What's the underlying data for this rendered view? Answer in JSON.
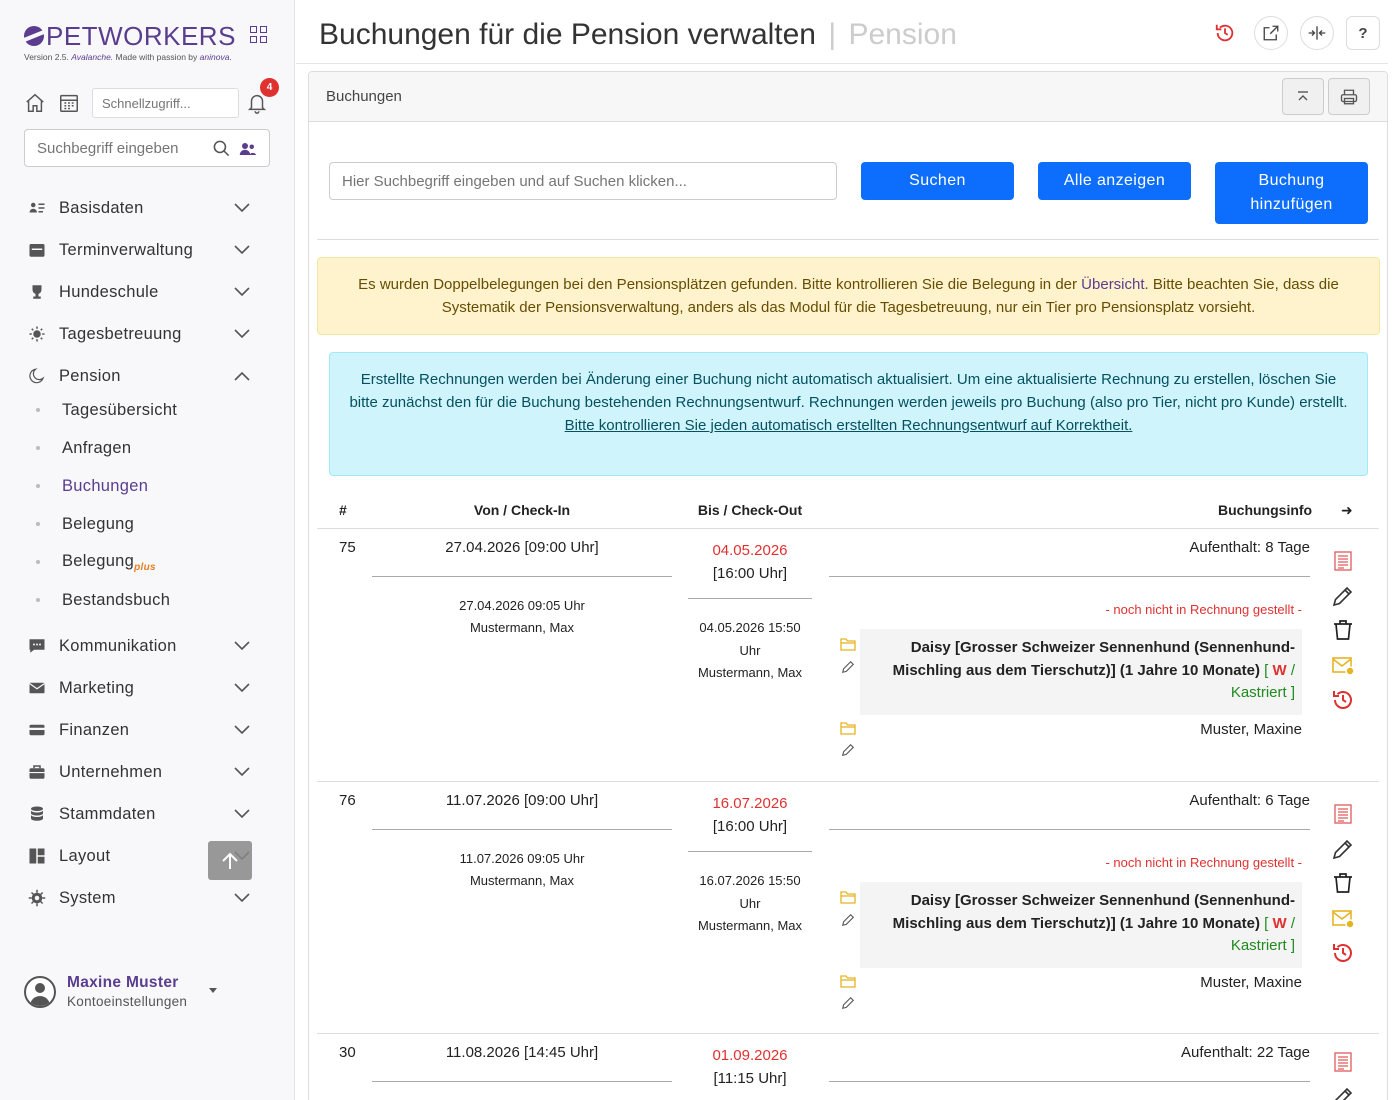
{
  "brand": {
    "name": "PETWORKERS",
    "version_prefix": "Version 2.5.",
    "version_name": "Avalanche.",
    "version_suffix": "Made with passion by",
    "company": "aninova."
  },
  "quick": {
    "placeholder": "Schnellzugriff...",
    "notifications": "4"
  },
  "sidebar_search": {
    "placeholder": "Suchbegriff eingeben"
  },
  "nav": {
    "basisdaten": "Basisdaten",
    "terminverwaltung": "Terminverwaltung",
    "hundeschule": "Hundeschule",
    "tagesbetreuung": "Tagesbetreuung",
    "pension": "Pension",
    "pension_sub": {
      "tagesuebersicht": "Tagesübersicht",
      "anfragen": "Anfragen",
      "buchungen": "Buchungen",
      "belegung": "Belegung",
      "belegungplus": "Belegung",
      "plus": "plus",
      "bestandsbuch": "Bestandsbuch"
    },
    "kommunikation": "Kommunikation",
    "marketing": "Marketing",
    "finanzen": "Finanzen",
    "unternehmen": "Unternehmen",
    "stammdaten": "Stammdaten",
    "layout": "Layout",
    "system": "System"
  },
  "user": {
    "name": "Maxine Muster",
    "sub": "Kontoeinstellungen"
  },
  "header": {
    "title": "Buchungen für die Pension verwalten",
    "separator": "|",
    "subtitle": "Pension",
    "help": "?"
  },
  "card": {
    "title": "Buchungen"
  },
  "search": {
    "placeholder": "Hier Suchbegriff eingeben und auf Suchen klicken...",
    "search_btn": "Suchen",
    "all_btn": "Alle anzeigen",
    "add_btn_line1": "Buchung",
    "add_btn_line2": "hinzufügen"
  },
  "warning": {
    "part1": "Es wurden Doppelbelegungen bei den Pensionsplätzen gefunden. Bitte kontrollieren Sie die Belegung in der",
    "link": "Übersicht",
    "part2": ". Bitte beachten Sie, dass die Systematik der Pensionsverwaltung, anders als das Modul für die Tagesbetreuung, nur ein Tier pro Pensionsplatz vorsieht."
  },
  "info": {
    "text": "Erstellte Rechnungen werden bei Änderung einer Buchung nicht automatisch aktualisiert. Um eine aktualisierte Rechnung zu erstellen, löschen Sie bitte zunächst den für die Buchung bestehenden Rechnungsentwurf. Rechnungen werden jeweils pro Buchung (also pro Tier, nicht pro Kunde) erstellt.",
    "link": "Bitte kontrollieren Sie jeden automatisch erstellten Rechnungsentwurf auf Korrektheit."
  },
  "table": {
    "col_num": "#",
    "col_from": "Von / Check-In",
    "col_to": "Bis / Check-Out",
    "col_info": "Buchungsinfo",
    "col_arrow": "➜"
  },
  "bookings": [
    {
      "num": "75",
      "from": "27.04.2026 [09:00 Uhr]",
      "from_created": "27.04.2026 09:05 Uhr",
      "from_user": "Mustermann, Max",
      "to_date": "04.05.2026",
      "to_time": "[16:00 Uhr]",
      "to_created": "04.05.2026 15:50",
      "to_created2": "Uhr",
      "to_user": "Mustermann, Max",
      "stay": "Aufenthalt: 8 Tage",
      "invoice": "- noch nicht in Rechnung gestellt -",
      "pet_line1": "Daisy [Grosser Schweizer Sennenhund (Sennenhund-",
      "pet_line2": "Mischling aus dem Tierschutz)] (1 Jahre 10 Monate)",
      "pet_open": "[",
      "pet_sex": "W",
      "pet_slash": "/",
      "pet_status": "Kastriert ]",
      "owner": "Muster, Maxine"
    },
    {
      "num": "76",
      "from": "11.07.2026 [09:00 Uhr]",
      "from_created": "11.07.2026 09:05 Uhr",
      "from_user": "Mustermann, Max",
      "to_date": "16.07.2026",
      "to_time": "[16:00 Uhr]",
      "to_created": "16.07.2026 15:50",
      "to_created2": "Uhr",
      "to_user": "Mustermann, Max",
      "stay": "Aufenthalt: 6 Tage",
      "invoice": "- noch nicht in Rechnung gestellt -",
      "pet_line1": "Daisy [Grosser Schweizer Sennenhund (Sennenhund-",
      "pet_line2": "Mischling aus dem Tierschutz)] (1 Jahre 10 Monate)",
      "pet_open": "[",
      "pet_sex": "W",
      "pet_slash": "/",
      "pet_status": "Kastriert ]",
      "owner": "Muster, Maxine"
    },
    {
      "num": "30",
      "from": "11.08.2026 [14:45 Uhr]",
      "to_date": "01.09.2026",
      "to_time": "[11:15 Uhr]",
      "stay": "Aufenthalt: 22 Tage"
    }
  ],
  "colors": {
    "brand": "#5b3d8f",
    "primary": "#0d6efd",
    "danger": "#e03131",
    "success": "#1f8a1f",
    "invoice_icon": "#e05a5a",
    "folder": "#e6b422"
  }
}
